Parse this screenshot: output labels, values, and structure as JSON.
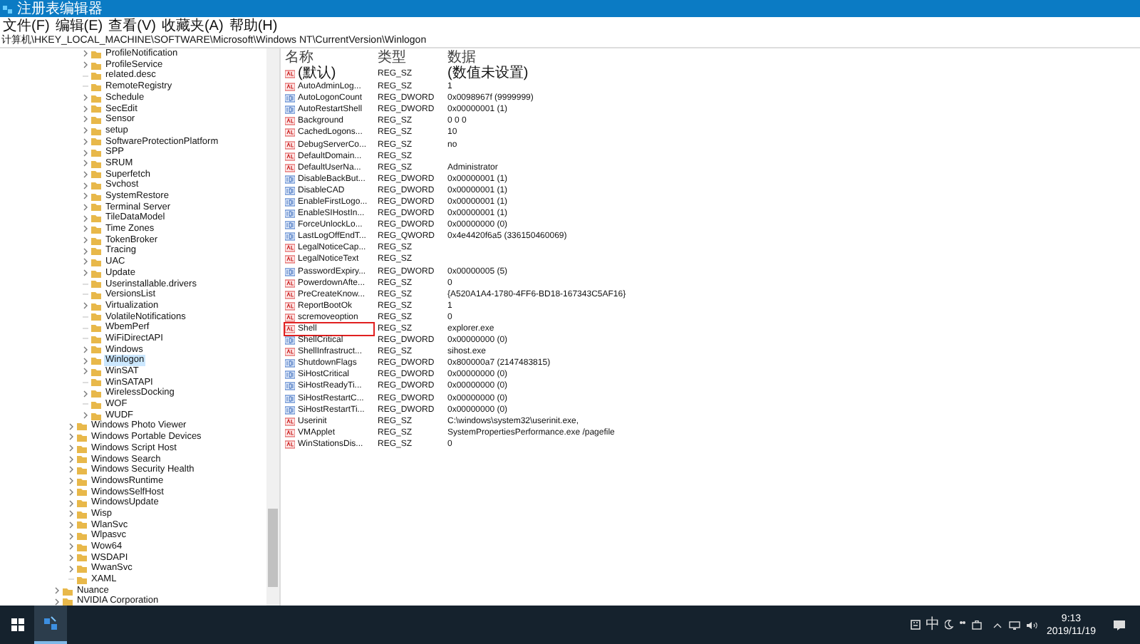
{
  "window": {
    "title": "注册表编辑器"
  },
  "menu": [
    "文件(F)",
    "编辑(E)",
    "查看(V)",
    "收藏夹(A)",
    "帮助(H)"
  ],
  "address": "计算机\\HKEY_LOCAL_MACHINE\\SOFTWARE\\Microsoft\\Windows NT\\CurrentVersion\\Winlogon",
  "tree": {
    "children": [
      {
        "children": [
          {
            "children": [
              {
                "label": "ProfileNotification",
                "expandable": true,
                "selected": false
              },
              {
                "label": "ProfileService",
                "expandable": true,
                "selected": false
              },
              {
                "label": "related.desc",
                "expandable": false,
                "selected": false
              },
              {
                "label": "RemoteRegistry",
                "expandable": false,
                "selected": false
              },
              {
                "label": "Schedule",
                "expandable": true,
                "selected": false
              },
              {
                "label": "SecEdit",
                "expandable": true,
                "selected": false
              },
              {
                "label": "Sensor",
                "expandable": true,
                "selected": false
              },
              {
                "label": "setup",
                "expandable": true,
                "selected": false
              },
              {
                "label": "SoftwareProtectionPlatform",
                "expandable": true,
                "selected": false
              },
              {
                "label": "SPP",
                "expandable": true,
                "selected": false
              },
              {
                "label": "SRUM",
                "expandable": true,
                "selected": false
              },
              {
                "label": "Superfetch",
                "expandable": true,
                "selected": false
              },
              {
                "label": "Svchost",
                "expandable": true,
                "selected": false
              },
              {
                "label": "SystemRestore",
                "expandable": true,
                "selected": false
              },
              {
                "label": "Terminal Server",
                "expandable": true,
                "selected": false
              },
              {
                "label": "TileDataModel",
                "expandable": true,
                "selected": false
              },
              {
                "label": "Time Zones",
                "expandable": true,
                "selected": false
              },
              {
                "label": "TokenBroker",
                "expandable": true,
                "selected": false
              },
              {
                "label": "Tracing",
                "expandable": true,
                "selected": false
              },
              {
                "label": "UAC",
                "expandable": true,
                "selected": false
              },
              {
                "label": "Update",
                "expandable": true,
                "selected": false
              },
              {
                "label": "Userinstallable.drivers",
                "expandable": false,
                "selected": false
              },
              {
                "label": "VersionsList",
                "expandable": false,
                "selected": false
              },
              {
                "label": "Virtualization",
                "expandable": true,
                "selected": false
              },
              {
                "label": "VolatileNotifications",
                "expandable": false,
                "selected": false
              },
              {
                "label": "WbemPerf",
                "expandable": false,
                "selected": false
              },
              {
                "label": "WiFiDirectAPI",
                "expandable": false,
                "selected": false
              },
              {
                "label": "Windows",
                "expandable": true,
                "selected": false
              },
              {
                "label": "Winlogon",
                "expandable": true,
                "selected": true
              },
              {
                "label": "WinSAT",
                "expandable": true,
                "selected": false
              },
              {
                "label": "WinSATAPI",
                "expandable": false,
                "selected": false
              },
              {
                "label": "WirelessDocking",
                "expandable": true,
                "selected": false
              },
              {
                "label": "WOF",
                "expandable": false,
                "selected": false
              },
              {
                "label": "WUDF",
                "expandable": true,
                "selected": false
              }
            ]
          },
          {
            "label": "Windows Photo Viewer",
            "expandable": true,
            "selected": false
          },
          {
            "label": "Windows Portable Devices",
            "expandable": true,
            "selected": false
          },
          {
            "label": "Windows Script Host",
            "expandable": true,
            "selected": false
          },
          {
            "label": "Windows Search",
            "expandable": true,
            "selected": false
          },
          {
            "label": "Windows Security Health",
            "expandable": true,
            "selected": false
          },
          {
            "label": "WindowsRuntime",
            "expandable": true,
            "selected": false
          },
          {
            "label": "WindowsSelfHost",
            "expandable": true,
            "selected": false
          },
          {
            "label": "WindowsUpdate",
            "expandable": true,
            "selected": false
          },
          {
            "label": "Wisp",
            "expandable": true,
            "selected": false
          },
          {
            "label": "WlanSvc",
            "expandable": true,
            "selected": false
          },
          {
            "label": "Wlpasvc",
            "expandable": true,
            "selected": false
          },
          {
            "label": "Wow64",
            "expandable": true,
            "selected": false
          },
          {
            "label": "WSDAPI",
            "expandable": true,
            "selected": false
          },
          {
            "label": "WwanSvc",
            "expandable": true,
            "selected": false
          },
          {
            "label": "XAML",
            "expandable": false,
            "selected": false
          }
        ]
      },
      {
        "label": "Nuance",
        "expandable": true,
        "selected": false
      },
      {
        "label": "NVIDIA Corporation",
        "expandable": true,
        "selected": false
      }
    ]
  },
  "values": {
    "columns": [
      "名称",
      "类型",
      "数据"
    ],
    "rows": [
      {
        "name": "(默认)",
        "type": "REG_SZ",
        "data": "(数值未设置)",
        "kind": "string",
        "highlighted": false
      },
      {
        "name": "AutoAdminLog...",
        "type": "REG_SZ",
        "data": "1",
        "kind": "string",
        "highlighted": false
      },
      {
        "name": "AutoLogonCount",
        "type": "REG_DWORD",
        "data": "0x0098967f (9999999)",
        "kind": "binary",
        "highlighted": false
      },
      {
        "name": "AutoRestartShell",
        "type": "REG_DWORD",
        "data": "0x00000001 (1)",
        "kind": "binary",
        "highlighted": false
      },
      {
        "name": "Background",
        "type": "REG_SZ",
        "data": "0 0 0",
        "kind": "string",
        "highlighted": false
      },
      {
        "name": "CachedLogons...",
        "type": "REG_SZ",
        "data": "10",
        "kind": "string",
        "highlighted": false
      },
      {
        "name": "DebugServerCo...",
        "type": "REG_SZ",
        "data": "no",
        "kind": "string",
        "highlighted": false
      },
      {
        "name": "DefaultDomain...",
        "type": "REG_SZ",
        "kind": "string",
        "highlighted": false
      },
      {
        "name": "DefaultUserNa...",
        "type": "REG_SZ",
        "data": "Administrator",
        "kind": "string",
        "highlighted": false
      },
      {
        "name": "DisableBackBut...",
        "type": "REG_DWORD",
        "data": "0x00000001 (1)",
        "kind": "binary",
        "highlighted": false
      },
      {
        "name": "DisableCAD",
        "type": "REG_DWORD",
        "data": "0x00000001 (1)",
        "kind": "binary",
        "highlighted": false
      },
      {
        "name": "EnableFirstLogo...",
        "type": "REG_DWORD",
        "data": "0x00000001 (1)",
        "kind": "binary",
        "highlighted": false
      },
      {
        "name": "EnableSIHostIn...",
        "type": "REG_DWORD",
        "data": "0x00000001 (1)",
        "kind": "binary",
        "highlighted": false
      },
      {
        "name": "ForceUnlockLo...",
        "type": "REG_DWORD",
        "data": "0x00000000 (0)",
        "kind": "binary",
        "highlighted": false
      },
      {
        "name": "LastLogOffEndT...",
        "type": "REG_QWORD",
        "data": "0x4e4420f6a5 (336150460069)",
        "kind": "binary",
        "highlighted": false
      },
      {
        "name": "LegalNoticeCap...",
        "type": "REG_SZ",
        "kind": "string",
        "highlighted": false
      },
      {
        "name": "LegalNoticeText",
        "type": "REG_SZ",
        "kind": "string",
        "highlighted": false
      },
      {
        "name": "PasswordExpiry...",
        "type": "REG_DWORD",
        "data": "0x00000005 (5)",
        "kind": "binary",
        "highlighted": false
      },
      {
        "name": "PowerdownAfte...",
        "type": "REG_SZ",
        "data": "0",
        "kind": "string",
        "highlighted": false
      },
      {
        "name": "PreCreateKnow...",
        "type": "REG_SZ",
        "data": "{A520A1A4-1780-4FF6-BD18-167343C5AF16}",
        "kind": "string",
        "highlighted": false
      },
      {
        "name": "ReportBootOk",
        "type": "REG_SZ",
        "data": "1",
        "kind": "string",
        "highlighted": false
      },
      {
        "name": "scremoveoption",
        "type": "REG_SZ",
        "data": "0",
        "kind": "string",
        "highlighted": false
      },
      {
        "name": "Shell",
        "type": "REG_SZ",
        "data": "explorer.exe",
        "kind": "string",
        "highlighted": true
      },
      {
        "name": "ShellCritical",
        "type": "REG_DWORD",
        "data": "0x00000000 (0)",
        "kind": "binary",
        "highlighted": false
      },
      {
        "name": "ShellInfrastruct...",
        "type": "REG_SZ",
        "data": "sihost.exe",
        "kind": "string",
        "highlighted": false
      },
      {
        "name": "ShutdownFlags",
        "type": "REG_DWORD",
        "data": "0x800000a7 (2147483815)",
        "kind": "binary",
        "highlighted": false
      },
      {
        "name": "SiHostCritical",
        "type": "REG_DWORD",
        "data": "0x00000000 (0)",
        "kind": "binary",
        "highlighted": false
      },
      {
        "name": "SiHostReadyTi...",
        "type": "REG_DWORD",
        "data": "0x00000000 (0)",
        "kind": "binary",
        "highlighted": false
      },
      {
        "name": "SiHostRestartC...",
        "type": "REG_DWORD",
        "data": "0x00000000 (0)",
        "kind": "binary",
        "highlighted": false
      },
      {
        "name": "SiHostRestartTi...",
        "type": "REG_DWORD",
        "data": "0x00000000 (0)",
        "kind": "binary",
        "highlighted": false
      },
      {
        "name": "Userinit",
        "type": "REG_SZ",
        "data": "C:\\windows\\system32\\userinit.exe,",
        "kind": "string",
        "highlighted": false
      },
      {
        "name": "VMApplet",
        "type": "REG_SZ",
        "data": "SystemPropertiesPerformance.exe /pagefile",
        "kind": "string",
        "highlighted": false
      },
      {
        "name": "WinStationsDis...",
        "type": "REG_SZ",
        "data": "0",
        "kind": "string",
        "highlighted": false
      }
    ]
  },
  "taskbar": {
    "ime": "中",
    "time": "9:13",
    "date": "2019/11/19"
  }
}
